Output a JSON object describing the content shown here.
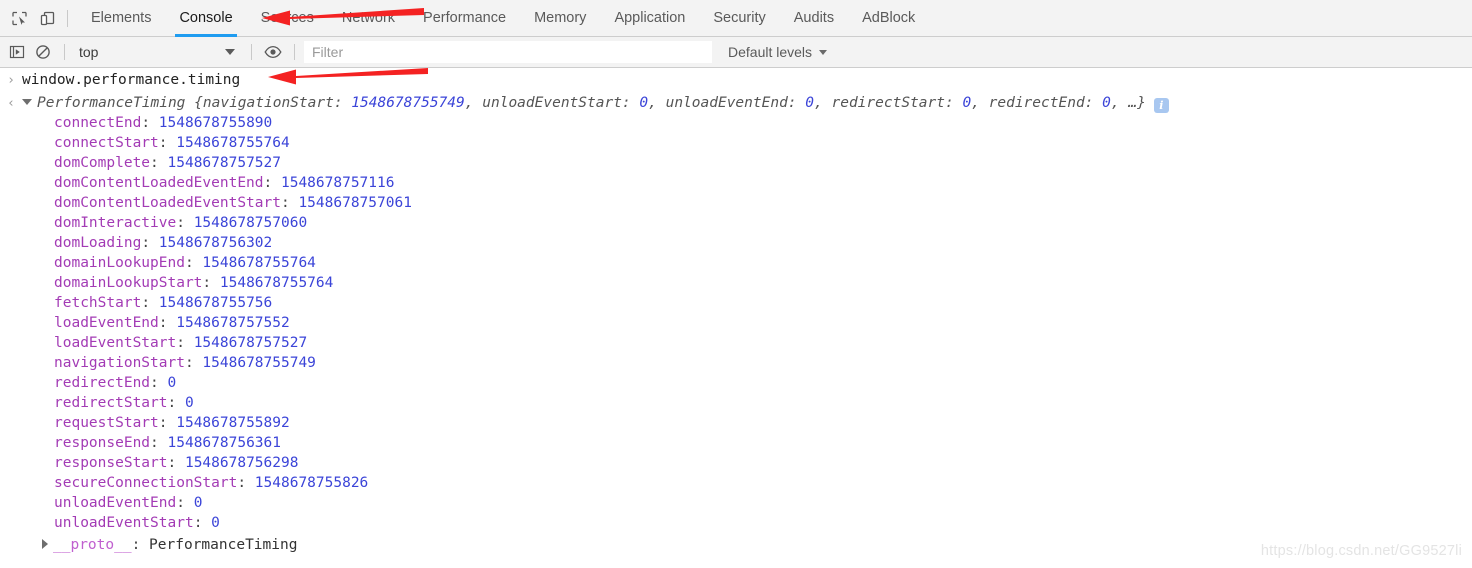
{
  "devtools": {
    "left_icons": [
      {
        "name": "inspect-element-icon",
        "title": "Inspect element"
      },
      {
        "name": "device-toolbar-icon",
        "title": "Toggle device toolbar"
      }
    ],
    "tabs": [
      {
        "label": "Elements",
        "active": false
      },
      {
        "label": "Console",
        "active": true
      },
      {
        "label": "Sources",
        "active": false
      },
      {
        "label": "Network",
        "active": false
      },
      {
        "label": "Performance",
        "active": false
      },
      {
        "label": "Memory",
        "active": false
      },
      {
        "label": "Application",
        "active": false
      },
      {
        "label": "Security",
        "active": false
      },
      {
        "label": "Audits",
        "active": false
      },
      {
        "label": "AdBlock",
        "active": false
      }
    ]
  },
  "console_toolbar": {
    "execute_icon": "execute-snippet-icon",
    "clear_icon": "clear-console-icon",
    "eye_icon": "live-expression-icon",
    "context": "top",
    "filter_placeholder": "Filter",
    "filter_value": "",
    "levels": "Default levels"
  },
  "console": {
    "prompt_chevron": "›",
    "result_chevron": "‹",
    "command": "window.performance.timing",
    "result_header": {
      "type": "PerformanceTiming",
      "preview_prefix": "PerformanceTiming {",
      "preview_entries": [
        {
          "key": "navigationStart",
          "value": "1548678755749"
        },
        {
          "key": "unloadEventStart",
          "value": "0"
        },
        {
          "key": "unloadEventEnd",
          "value": "0"
        },
        {
          "key": "redirectStart",
          "value": "0"
        },
        {
          "key": "redirectEnd",
          "value": "0"
        }
      ],
      "preview_suffix": ", …}",
      "info_badge": "i"
    },
    "properties": [
      {
        "key": "connectEnd",
        "value": "1548678755890"
      },
      {
        "key": "connectStart",
        "value": "1548678755764"
      },
      {
        "key": "domComplete",
        "value": "1548678757527"
      },
      {
        "key": "domContentLoadedEventEnd",
        "value": "1548678757116"
      },
      {
        "key": "domContentLoadedEventStart",
        "value": "1548678757061"
      },
      {
        "key": "domInteractive",
        "value": "1548678757060"
      },
      {
        "key": "domLoading",
        "value": "1548678756302"
      },
      {
        "key": "domainLookupEnd",
        "value": "1548678755764"
      },
      {
        "key": "domainLookupStart",
        "value": "1548678755764"
      },
      {
        "key": "fetchStart",
        "value": "1548678755756"
      },
      {
        "key": "loadEventEnd",
        "value": "1548678757552"
      },
      {
        "key": "loadEventStart",
        "value": "1548678757527"
      },
      {
        "key": "navigationStart",
        "value": "1548678755749"
      },
      {
        "key": "redirectEnd",
        "value": "0"
      },
      {
        "key": "redirectStart",
        "value": "0"
      },
      {
        "key": "requestStart",
        "value": "1548678755892"
      },
      {
        "key": "responseEnd",
        "value": "1548678756361"
      },
      {
        "key": "responseStart",
        "value": "1548678756298"
      },
      {
        "key": "secureConnectionStart",
        "value": "1548678755826"
      },
      {
        "key": "unloadEventEnd",
        "value": "0"
      },
      {
        "key": "unloadEventStart",
        "value": "0"
      }
    ],
    "proto": {
      "key": "__proto__",
      "value": "PerformanceTiming"
    }
  },
  "annotations": {
    "arrow_tabs": "red-arrow-pointing-to-console-tab",
    "arrow_command": "red-arrow-pointing-to-command",
    "arrow_color": "#f42222"
  },
  "watermark": "https://blog.csdn.net/GG9527li"
}
